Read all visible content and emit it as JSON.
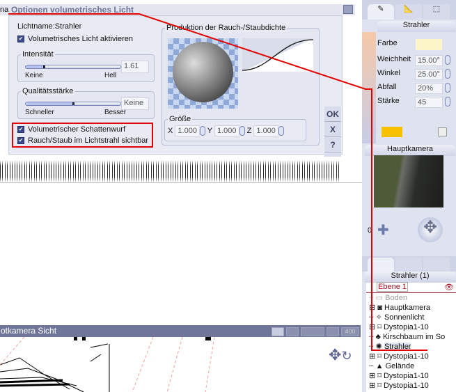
{
  "dialog": {
    "left_cut_text": "na",
    "title": "Optionen volumetrisches Licht",
    "light_name": "Lichtname:Strahler",
    "enable_label": "Volumetrisches Licht aktivieren",
    "intensity": {
      "legend": "Intensität",
      "min_label": "Keine",
      "max_label": "Hell",
      "value": "1.61",
      "slider_fraction": 0.18
    },
    "quality": {
      "legend": "Qualitätsstärke",
      "min_label": "Schneller",
      "max_label": "Besser",
      "value": "Keine",
      "slider_fraction": 0.5
    },
    "shadow_label": "Volumetrischer Schattenwurf",
    "smoke_label": "Rauch/Staub im Lichtstrahl sichtbar",
    "density": {
      "legend": "Produktion der Rauch-/Staubdichte"
    },
    "size": {
      "legend": "Größe",
      "x_label": "X",
      "x": "1.000",
      "y_label": "Y",
      "y": "1.000",
      "z_label": "Z",
      "z": "1.000"
    },
    "ok": "OK",
    "cancel": "X",
    "help": "?"
  },
  "viewport": {
    "title": "otkamera Sicht",
    "zoom": "400"
  },
  "right_panel": {
    "light_header": "Strahler",
    "props": [
      {
        "label": "Farbe",
        "value": ""
      },
      {
        "label": "Weichheit",
        "value": "15.00°"
      },
      {
        "label": "Winkel",
        "value": "25.00°"
      },
      {
        "label": "Abfall",
        "value": "20%"
      },
      {
        "label": "Stärke",
        "value": "45"
      }
    ],
    "colors": {
      "light": "#fdf5c8",
      "swatch": "#f7c100"
    },
    "camera_header": "Hauptkamera",
    "camera_counter": "0",
    "scene_header": "Strahler (1)",
    "layer": "Ebene 1",
    "tree": [
      {
        "label": "Boden",
        "expand": false
      },
      {
        "label": "Hauptkamera",
        "expand": true
      },
      {
        "label": "Sonnenlicht",
        "expand": false
      },
      {
        "label": "Dystopia1-10",
        "expand": true
      },
      {
        "label": "Kirschbaum im So",
        "expand": false
      },
      {
        "label": "Strahler",
        "expand": false,
        "selected": true
      },
      {
        "label": "Dystopia1-10",
        "expand": true
      },
      {
        "label": "Gelände",
        "expand": false
      },
      {
        "label": "Dystopia1-10",
        "expand": true
      },
      {
        "label": "Dystopia1-10",
        "expand": true
      }
    ]
  }
}
